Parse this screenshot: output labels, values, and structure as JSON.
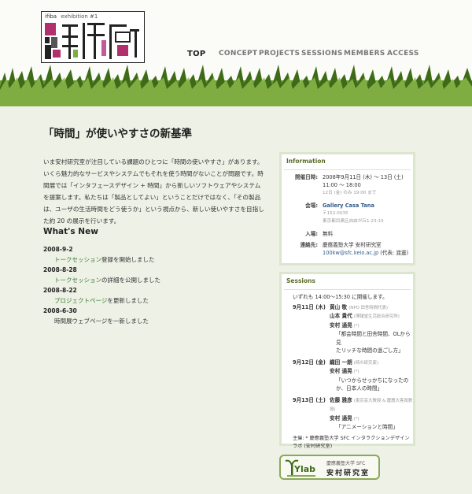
{
  "logo": {
    "prefix": "ifiba",
    "subtitle": "exhibition #1"
  },
  "nav": [
    {
      "label": "TOP",
      "active": true
    },
    {
      "label": "CONCEPT"
    },
    {
      "label": "PROJECTS"
    },
    {
      "label": "SESSIONS"
    },
    {
      "label": "MEMBERS"
    },
    {
      "label": "ACCESS"
    }
  ],
  "main": {
    "title": "「時間」が使いやすさの新基準",
    "intro": "いま安村研究室が注目している課題のひとつに「時間の使いやすさ」があります。いくら魅力的なサービスやシステムでもそれを使う時間がないことが問題です。時間展では「インタフェースデザイン + 時間」から新しいソフトウェアやシステムを提案します。私たちは「製品としてよい」ということだけではなく、「その製品は、ユーザの生活時間をどう使うか」という視点から、新しい使いやすさを目指した約 20 の展示を行います。",
    "whats_new_title": "What's New",
    "news": [
      {
        "date": "2008-9-2",
        "link": "トークセッション",
        "rest": "登録を開始しました"
      },
      {
        "date": "2008-8-28",
        "link": "トークセッション",
        "rest": "の詳細を公開しました"
      },
      {
        "date": "2008-8-22",
        "link": "プロジェクトページ",
        "rest": "を更新しました"
      },
      {
        "date": "2008-6-30",
        "link": "",
        "rest": "時間展ウェブページを一新しました"
      }
    ]
  },
  "info": {
    "heading": "Information",
    "dates_label": "開催日時:",
    "dates_value": "2008年9月11日 (木) 〜 13日 (土)",
    "hours": "11:00 〜 18:00",
    "hours_note": "12日 (金) のみ 19:00 まで",
    "venue_label": "会場:",
    "venue_name": "Gallery Casa Tana",
    "venue_postal": "〒152-0035",
    "venue_address": "東京都目黒区自由が丘1-23-15",
    "admission_label": "入場:",
    "admission_value": "無料",
    "contact_label": "連絡先:",
    "contact_org": "慶應義塾大学 安村研究室",
    "contact_email": "100kw@sfc.keio.ac.jp",
    "contact_person": "(代表: 渡邊)"
  },
  "sessions": {
    "heading": "Sessions",
    "intro": "いずれも 14:00〜15:30 に開催します。",
    "days": [
      {
        "date": "9月11日 (木)",
        "speakers": [
          {
            "name": "黄山 敬",
            "aff": "(NPO 田舎時間代表)"
          },
          {
            "name": "山本 貴代",
            "aff": "(博報堂生活総合研究所)"
          },
          {
            "name": "安村 通晃",
            "aff": "(*)"
          }
        ],
        "talk1": "「都会時間と田舎時間、OLから見",
        "talk2": "たリッチな時間の過ごし方」"
      },
      {
        "date": "9月12日 (金)",
        "speakers": [
          {
            "name": "織田 一朗",
            "aff": "(時の研究家)"
          },
          {
            "name": "安村 通晃",
            "aff": "(*)"
          }
        ],
        "talk1": "「いつからせっかちになったの",
        "talk2": "か、日本人の時間」"
      },
      {
        "date": "9月13日 (土)",
        "speakers": [
          {
            "name": "佐藤 雅彦",
            "aff": "(東京芸大教授 & 慶應大客員教授)"
          },
          {
            "name": "安村 通晃",
            "aff": "(*)"
          }
        ],
        "talk1": "「アニメーションと時間」",
        "talk2": ""
      }
    ],
    "organizer1": "主催: * 慶應義塾大学 SFC インタラクションデザイン",
    "organizer2": "ラボ (安村研究室)"
  },
  "banner": {
    "logo_text": "Ylab",
    "line1": "慶應義塾大学 SFC",
    "line2": "安村研究室"
  },
  "colors": {
    "accent_green": "#5a6d28",
    "link_green": "#3a7a32",
    "link_blue": "#2f5a8a",
    "box_border": "#dce5cd"
  }
}
